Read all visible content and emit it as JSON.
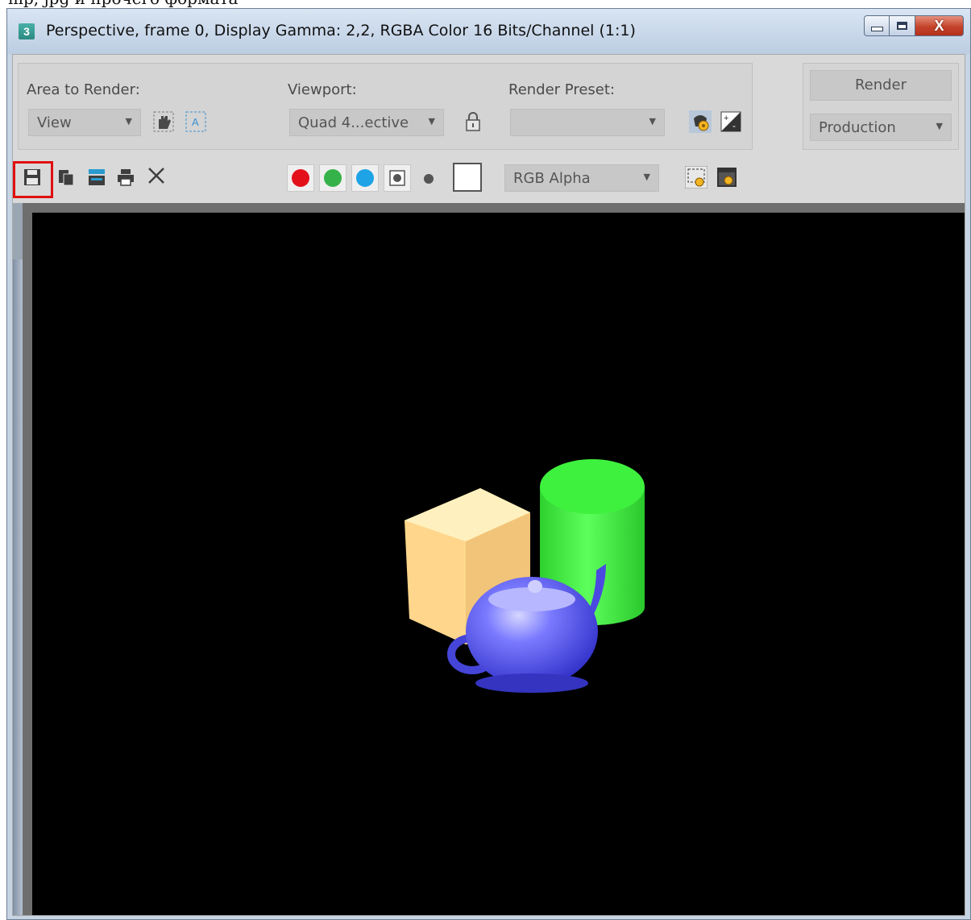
{
  "window": {
    "app_icon_label": "3",
    "title": "Perspective, frame 0, Display Gamma: 2,2, RGBA Color 16 Bits/Channel (1:1)",
    "controls": {
      "minimize": "minimize",
      "maximize": "maximize",
      "close": "X"
    }
  },
  "settings": {
    "area_to_render": {
      "label": "Area to Render:",
      "value": "View"
    },
    "viewport": {
      "label": "Viewport:",
      "value": "Quad 4...ective"
    },
    "render_preset": {
      "label": "Render Preset:",
      "value": ""
    },
    "render_button": "Render",
    "production": {
      "value": "Production"
    }
  },
  "toolbar": {
    "display_channel": "RGB Alpha",
    "channels": [
      {
        "name": "red-channel",
        "color": "#e3101a"
      },
      {
        "name": "green-channel",
        "color": "#36b24a"
      },
      {
        "name": "blue-channel",
        "color": "#1ea4e6"
      }
    ],
    "swatch_color": "#ffffff"
  },
  "scene": {
    "background": "#000000",
    "objects": [
      {
        "name": "box",
        "color": "#ffd68a"
      },
      {
        "name": "cylinder",
        "color": "#33ee33"
      },
      {
        "name": "teapot",
        "color": "#5555ee"
      }
    ]
  },
  "highlight_color": "#e01010",
  "top_strip_text": "mp, jpg и прочего формата"
}
